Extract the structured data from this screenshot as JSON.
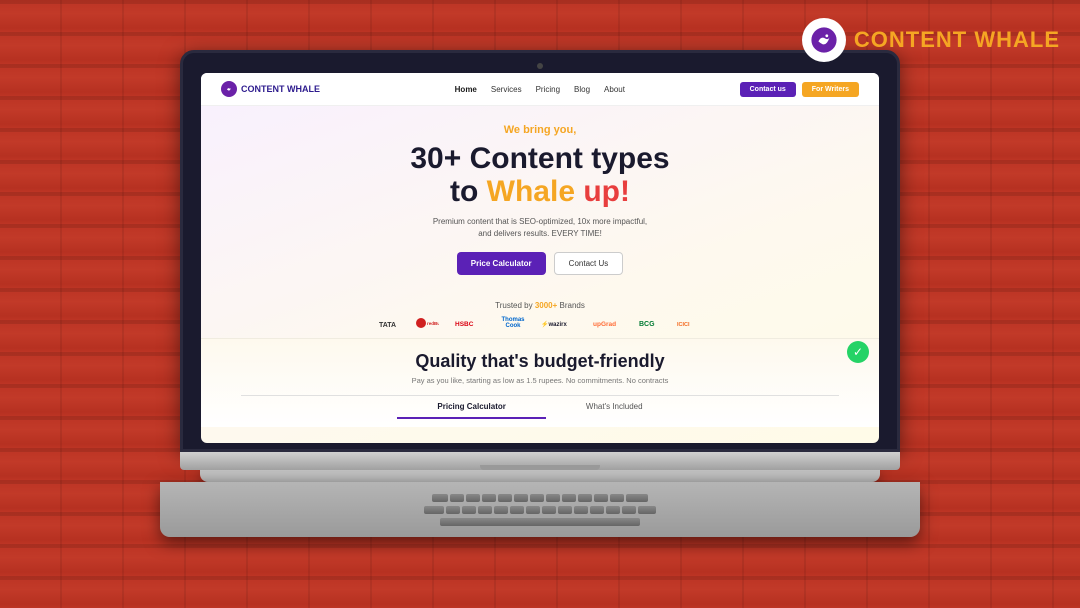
{
  "background": {
    "color": "#c0392b"
  },
  "top_logo": {
    "brand": "CONTENT",
    "whale": "WHALE"
  },
  "laptop": {
    "website": {
      "nav": {
        "logo_text": "CONTENT WHALE",
        "links": [
          {
            "label": "Home",
            "active": true
          },
          {
            "label": "Services",
            "active": false
          },
          {
            "label": "Pricing",
            "active": false
          },
          {
            "label": "Blog",
            "active": false
          },
          {
            "label": "About",
            "active": false
          }
        ],
        "btn_contact": "Contact us",
        "btn_writers": "For Writers"
      },
      "hero": {
        "tagline": "We bring you,",
        "title_line1": "30+ Content types",
        "title_line2_to": "to ",
        "title_line2_whale": "Whale",
        "title_line2_up": " up!",
        "description": "Premium content that is SEO-optimized, 10x more impactful,\nand delivers results. EVERY TIME!",
        "btn_price": "Price Calculator",
        "btn_contact": "Contact Us"
      },
      "trusted": {
        "prefix": "Trusted by ",
        "count": "3000+",
        "suffix": " Brands",
        "brands": [
          "TATA",
          "redBus",
          "HSBC",
          "Thomas Cook",
          "wazirx",
          "upGrad",
          "BCG",
          "ICICI"
        ]
      },
      "quality": {
        "title": "Quality that's budget-friendly",
        "description": "Pay as you like, starting as low as 1.5 rupees. No commitments. No contracts",
        "tabs": [
          "Pricing Calculator",
          "What's Included"
        ]
      }
    }
  }
}
